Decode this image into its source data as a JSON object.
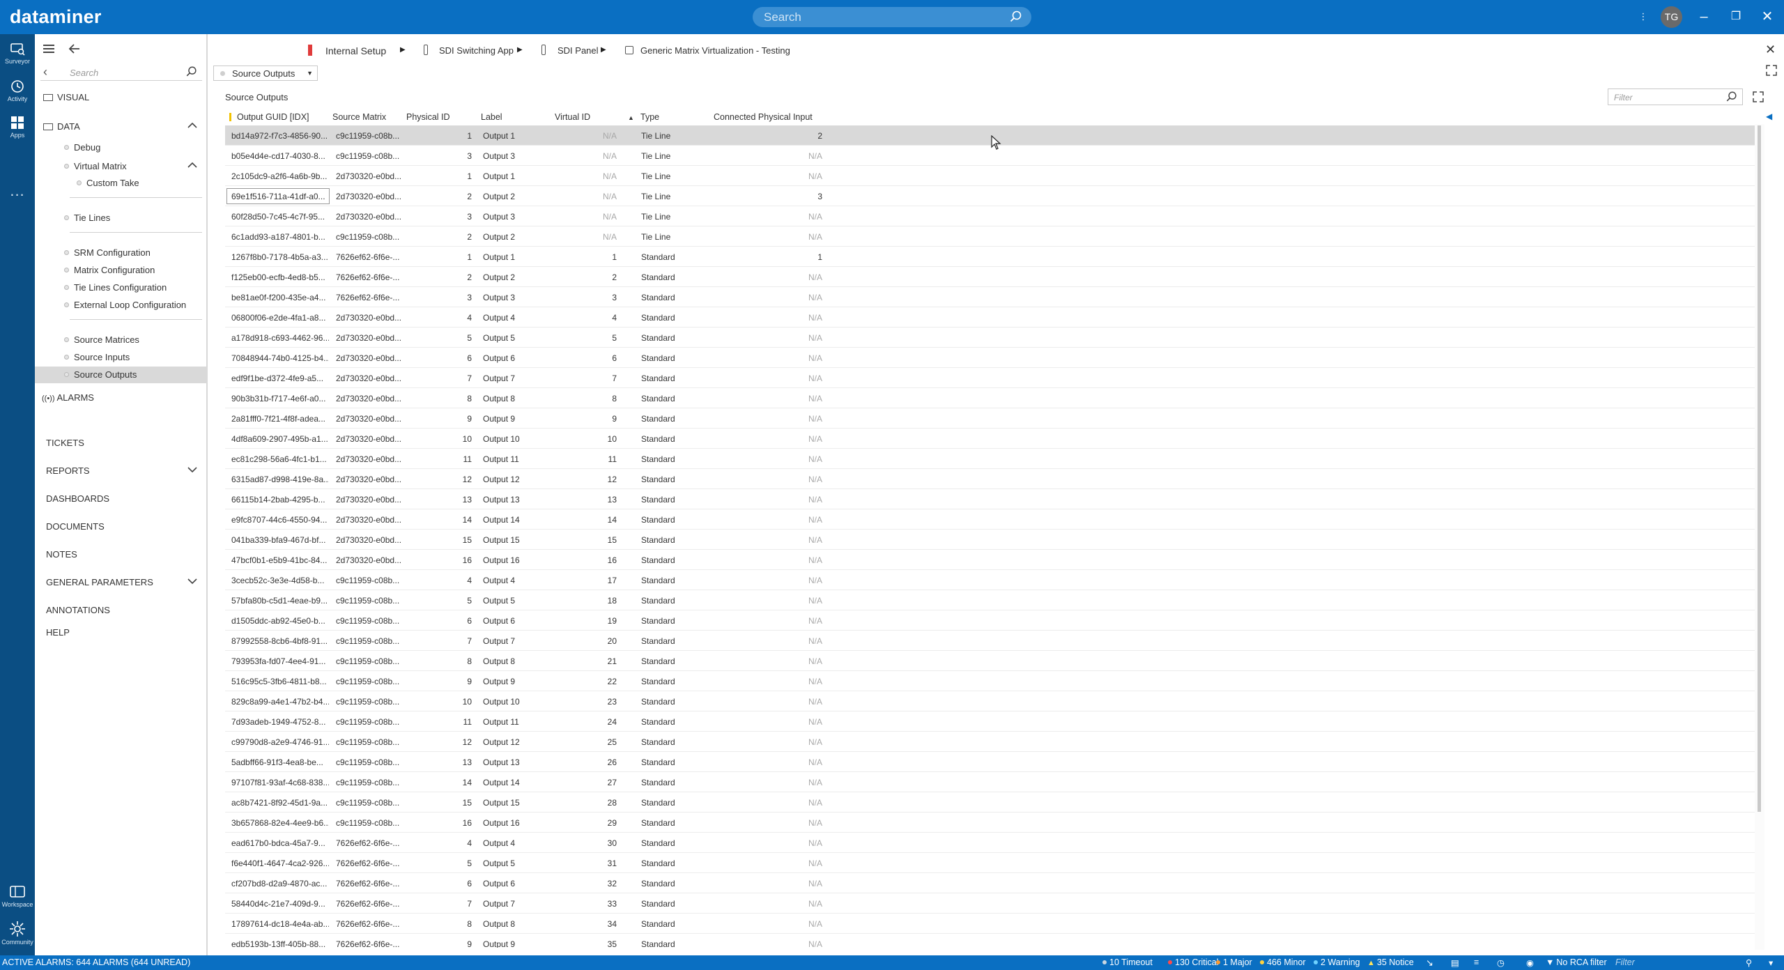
{
  "app": {
    "logo": "dataminer",
    "search_placeholder": "Search",
    "user_initials": "TG"
  },
  "rail": [
    {
      "label": "Surveyor",
      "icon": "surveyor-icon"
    },
    {
      "label": "Activity",
      "icon": "activity-icon"
    },
    {
      "label": "Apps",
      "icon": "apps-icon"
    },
    {
      "label": "Workspace",
      "icon": "workspace-icon"
    },
    {
      "label": "Community",
      "icon": "community-icon"
    }
  ],
  "rail_more": "...",
  "sidebar": {
    "search_placeholder": "Search",
    "visual": "VISUAL",
    "data": "DATA",
    "debug": "Debug",
    "virtual_matrix": "Virtual Matrix",
    "custom_take": "Custom Take",
    "tie_lines": "Tie Lines",
    "srm_configuration": "SRM Configuration",
    "matrix_configuration": "Matrix Configuration",
    "tie_lines_configuration": "Tie Lines Configuration",
    "external_loop_configuration": "External Loop Configuration",
    "source_matrices": "Source Matrices",
    "source_inputs": "Source Inputs",
    "source_outputs": "Source Outputs",
    "alarms": "ALARMS",
    "tickets": "TICKETS",
    "reports": "REPORTS",
    "dashboards": "DASHBOARDS",
    "documents": "DOCUMENTS",
    "notes": "NOTES",
    "general_parameters": "GENERAL PARAMETERS",
    "annotations": "ANNOTATIONS",
    "help": "HELP"
  },
  "breadcrumb": [
    "Internal Setup",
    "SDI Switching App",
    "SDI Panel",
    "Generic Matrix Virtualization - Testing"
  ],
  "module_selector": "Source Outputs",
  "panel_title": "Source Outputs",
  "filter_placeholder": "Filter",
  "table": {
    "columns": [
      "Output GUID [IDX]",
      "Source Matrix",
      "Physical ID",
      "Label",
      "Virtual ID",
      "Type",
      "Connected Physical Input"
    ],
    "rows": [
      [
        "bd14a972-f7c3-4856-90...",
        "c9c11959-c08b...",
        "1",
        "Output 1",
        "N/A",
        "Tie Line",
        "2"
      ],
      [
        "b05e4d4e-cd17-4030-8...",
        "c9c11959-c08b...",
        "3",
        "Output 3",
        "N/A",
        "Tie Line",
        "N/A"
      ],
      [
        "2c105dc9-a2f6-4a6b-9b...",
        "2d730320-e0bd...",
        "1",
        "Output 1",
        "N/A",
        "Tie Line",
        "N/A"
      ],
      [
        "69e1f516-711a-41df-a0...",
        "2d730320-e0bd...",
        "2",
        "Output 2",
        "N/A",
        "Tie Line",
        "3"
      ],
      [
        "60f28d50-7c45-4c7f-95...",
        "2d730320-e0bd...",
        "3",
        "Output 3",
        "N/A",
        "Tie Line",
        "N/A"
      ],
      [
        "6c1add93-a187-4801-b...",
        "c9c11959-c08b...",
        "2",
        "Output 2",
        "N/A",
        "Tie Line",
        "N/A"
      ],
      [
        "1267f8b0-7178-4b5a-a3...",
        "7626ef62-6f6e-...",
        "1",
        "Output 1",
        "1",
        "Standard",
        "1"
      ],
      [
        "f125eb00-ecfb-4ed8-b5...",
        "7626ef62-6f6e-...",
        "2",
        "Output 2",
        "2",
        "Standard",
        "N/A"
      ],
      [
        "be81ae0f-f200-435e-a4...",
        "7626ef62-6f6e-...",
        "3",
        "Output 3",
        "3",
        "Standard",
        "N/A"
      ],
      [
        "06800f06-e2de-4fa1-a8...",
        "2d730320-e0bd...",
        "4",
        "Output 4",
        "4",
        "Standard",
        "N/A"
      ],
      [
        "a178d918-c693-4462-96...",
        "2d730320-e0bd...",
        "5",
        "Output 5",
        "5",
        "Standard",
        "N/A"
      ],
      [
        "70848944-74b0-4125-b4...",
        "2d730320-e0bd...",
        "6",
        "Output 6",
        "6",
        "Standard",
        "N/A"
      ],
      [
        "edf9f1be-d372-4fe9-a5...",
        "2d730320-e0bd...",
        "7",
        "Output 7",
        "7",
        "Standard",
        "N/A"
      ],
      [
        "90b3b31b-f717-4e6f-a0...",
        "2d730320-e0bd...",
        "8",
        "Output 8",
        "8",
        "Standard",
        "N/A"
      ],
      [
        "2a81fff0-7f21-4f8f-adea...",
        "2d730320-e0bd...",
        "9",
        "Output 9",
        "9",
        "Standard",
        "N/A"
      ],
      [
        "4df8a609-2907-495b-a1...",
        "2d730320-e0bd...",
        "10",
        "Output 10",
        "10",
        "Standard",
        "N/A"
      ],
      [
        "ec81c298-56a6-4fc1-b1...",
        "2d730320-e0bd...",
        "11",
        "Output 11",
        "11",
        "Standard",
        "N/A"
      ],
      [
        "6315ad87-d998-419e-8a...",
        "2d730320-e0bd...",
        "12",
        "Output 12",
        "12",
        "Standard",
        "N/A"
      ],
      [
        "66115b14-2bab-4295-b...",
        "2d730320-e0bd...",
        "13",
        "Output 13",
        "13",
        "Standard",
        "N/A"
      ],
      [
        "e9fc8707-44c6-4550-94...",
        "2d730320-e0bd...",
        "14",
        "Output 14",
        "14",
        "Standard",
        "N/A"
      ],
      [
        "041ba339-bfa9-467d-bf...",
        "2d730320-e0bd...",
        "15",
        "Output 15",
        "15",
        "Standard",
        "N/A"
      ],
      [
        "47bcf0b1-e5b9-41bc-84...",
        "2d730320-e0bd...",
        "16",
        "Output 16",
        "16",
        "Standard",
        "N/A"
      ],
      [
        "3cecb52c-3e3e-4d58-b...",
        "c9c11959-c08b...",
        "4",
        "Output 4",
        "17",
        "Standard",
        "N/A"
      ],
      [
        "57bfa80b-c5d1-4eae-b9...",
        "c9c11959-c08b...",
        "5",
        "Output 5",
        "18",
        "Standard",
        "N/A"
      ],
      [
        "d1505ddc-ab92-45e0-b...",
        "c9c11959-c08b...",
        "6",
        "Output 6",
        "19",
        "Standard",
        "N/A"
      ],
      [
        "87992558-8cb6-4bf8-91...",
        "c9c11959-c08b...",
        "7",
        "Output 7",
        "20",
        "Standard",
        "N/A"
      ],
      [
        "793953fa-fd07-4ee4-91...",
        "c9c11959-c08b...",
        "8",
        "Output 8",
        "21",
        "Standard",
        "N/A"
      ],
      [
        "516c95c5-3fb6-4811-b8...",
        "c9c11959-c08b...",
        "9",
        "Output 9",
        "22",
        "Standard",
        "N/A"
      ],
      [
        "829c8a99-a4e1-47b2-b4...",
        "c9c11959-c08b...",
        "10",
        "Output 10",
        "23",
        "Standard",
        "N/A"
      ],
      [
        "7d93adeb-1949-4752-8...",
        "c9c11959-c08b...",
        "11",
        "Output 11",
        "24",
        "Standard",
        "N/A"
      ],
      [
        "c99790d8-a2e9-4746-91...",
        "c9c11959-c08b...",
        "12",
        "Output 12",
        "25",
        "Standard",
        "N/A"
      ],
      [
        "5adbff66-91f3-4ea8-be...",
        "c9c11959-c08b...",
        "13",
        "Output 13",
        "26",
        "Standard",
        "N/A"
      ],
      [
        "97107f81-93af-4c68-838...",
        "c9c11959-c08b...",
        "14",
        "Output 14",
        "27",
        "Standard",
        "N/A"
      ],
      [
        "ac8b7421-8f92-45d1-9a...",
        "c9c11959-c08b...",
        "15",
        "Output 15",
        "28",
        "Standard",
        "N/A"
      ],
      [
        "3b657868-82e4-4ee9-b6...",
        "c9c11959-c08b...",
        "16",
        "Output 16",
        "29",
        "Standard",
        "N/A"
      ],
      [
        "ead617b0-bdca-45a7-9...",
        "7626ef62-6f6e-...",
        "4",
        "Output 4",
        "30",
        "Standard",
        "N/A"
      ],
      [
        "f6e440f1-4647-4ca2-926...",
        "7626ef62-6f6e-...",
        "5",
        "Output 5",
        "31",
        "Standard",
        "N/A"
      ],
      [
        "cf207bd8-d2a9-4870-ac...",
        "7626ef62-6f6e-...",
        "6",
        "Output 6",
        "32",
        "Standard",
        "N/A"
      ],
      [
        "58440d4c-21e7-409d-9...",
        "7626ef62-6f6e-...",
        "7",
        "Output 7",
        "33",
        "Standard",
        "N/A"
      ],
      [
        "17897614-dc18-4e4a-ab...",
        "7626ef62-6f6e-...",
        "8",
        "Output 8",
        "34",
        "Standard",
        "N/A"
      ],
      [
        "edb5193b-13ff-405b-88...",
        "7626ef62-6f6e-...",
        "9",
        "Output 9",
        "35",
        "Standard",
        "N/A"
      ]
    ]
  },
  "status": {
    "active_alarms": "ACTIVE ALARMS: 644 ALARMS (644 UNREAD)",
    "timeout": "10 Timeout",
    "critical": "130 Critical",
    "major": "1 Major",
    "minor": "466 Minor",
    "warning": "2 Warning",
    "notice": "35 Notice",
    "rca": "No RCA filter",
    "filter_placeholder": "Filter"
  },
  "colors": {
    "brand_blue": "#0a6fc2",
    "rail_blue": "#0b4e83",
    "critical": "#ff4a4a",
    "major": "#ff9a2e",
    "minor": "#ffd23f",
    "warning": "#6fd3ff",
    "notice": "#ffe45c"
  }
}
